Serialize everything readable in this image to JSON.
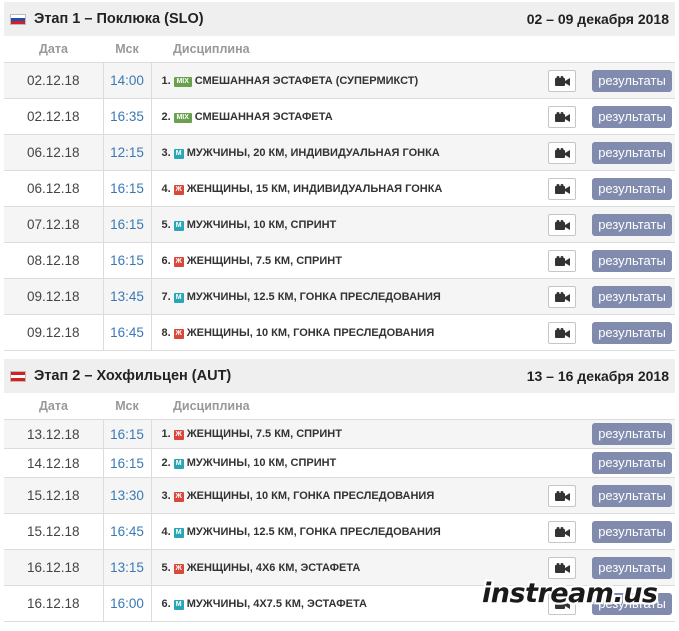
{
  "headers": {
    "date": "Дата",
    "time": "Мск",
    "discipline": "Дисциплина"
  },
  "results_label": "результаты",
  "watermark": "instream.us",
  "stages": [
    {
      "title": "Этап 1 – Поклюка (SLO)",
      "flag": "flag-slovenia",
      "dates": "02 – 09 декабря 2018",
      "events": [
        {
          "date": "02.12.18",
          "time": "14:00",
          "num": "1.",
          "badge": "MIX",
          "discipline": "СМЕШАННАЯ ЭСТАФЕТА (СУПЕРМИКСТ)",
          "video": true
        },
        {
          "date": "02.12.18",
          "time": "16:35",
          "num": "2.",
          "badge": "MIX",
          "discipline": "СМЕШАННАЯ ЭСТАФЕТА",
          "video": true
        },
        {
          "date": "06.12.18",
          "time": "12:15",
          "num": "3.",
          "badge": "М",
          "discipline": "МУЖЧИНЫ, 20 КМ, ИНДИВИДУАЛЬНАЯ ГОНКА",
          "video": true
        },
        {
          "date": "06.12.18",
          "time": "16:15",
          "num": "4.",
          "badge": "Ж",
          "discipline": "ЖЕНЩИНЫ, 15 КМ, ИНДИВИДУАЛЬНАЯ ГОНКА",
          "video": true
        },
        {
          "date": "07.12.18",
          "time": "16:15",
          "num": "5.",
          "badge": "М",
          "discipline": "МУЖЧИНЫ, 10 КМ, СПРИНТ",
          "video": true
        },
        {
          "date": "08.12.18",
          "time": "16:15",
          "num": "6.",
          "badge": "Ж",
          "discipline": "ЖЕНЩИНЫ, 7.5 КМ, СПРИНТ",
          "video": true
        },
        {
          "date": "09.12.18",
          "time": "13:45",
          "num": "7.",
          "badge": "М",
          "discipline": "МУЖЧИНЫ, 12.5 КМ, ГОНКА ПРЕСЛЕДОВАНИЯ",
          "video": true
        },
        {
          "date": "09.12.18",
          "time": "16:45",
          "num": "8.",
          "badge": "Ж",
          "discipline": "ЖЕНЩИНЫ, 10 КМ, ГОНКА ПРЕСЛЕДОВАНИЯ",
          "video": true
        }
      ]
    },
    {
      "title": "Этап 2 – Хохфильцен (AUT)",
      "flag": "flag-austria",
      "dates": "13 – 16 декабря 2018",
      "events": [
        {
          "date": "13.12.18",
          "time": "16:15",
          "num": "1.",
          "badge": "Ж",
          "discipline": "ЖЕНЩИНЫ, 7.5 КМ, СПРИНТ",
          "video": false
        },
        {
          "date": "14.12.18",
          "time": "16:15",
          "num": "2.",
          "badge": "М",
          "discipline": "МУЖЧИНЫ, 10 КМ, СПРИНТ",
          "video": false
        },
        {
          "date": "15.12.18",
          "time": "13:30",
          "num": "3.",
          "badge": "Ж",
          "discipline": "ЖЕНЩИНЫ, 10 КМ, ГОНКА ПРЕСЛЕДОВАНИЯ",
          "video": true
        },
        {
          "date": "15.12.18",
          "time": "16:45",
          "num": "4.",
          "badge": "М",
          "discipline": "МУЖЧИНЫ, 12.5 КМ, ГОНКА ПРЕСЛЕДОВАНИЯ",
          "video": true
        },
        {
          "date": "16.12.18",
          "time": "13:15",
          "num": "5.",
          "badge": "Ж",
          "discipline": "ЖЕНЩИНЫ, 4Х6 КМ, ЭСТАФЕТА",
          "video": true
        },
        {
          "date": "16.12.18",
          "time": "16:00",
          "num": "6.",
          "badge": "М",
          "discipline": "МУЖЧИНЫ, 4Х7.5 КМ, ЭСТАФЕТА",
          "video": true
        }
      ]
    }
  ]
}
